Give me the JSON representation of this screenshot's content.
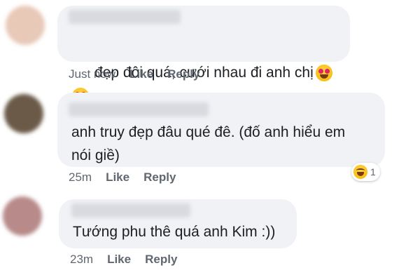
{
  "comments": [
    {
      "text": "đẹp đôi quá, cưới nhau đi anh chị",
      "time": "Just now",
      "like": "Like",
      "reply": "Reply",
      "avatar_color": "#e8c9b8",
      "emoji_icons": [
        "heart-eyes-emoji",
        "heart-eyes-emoji"
      ]
    },
    {
      "text": "anh truy đẹp đâu qué đê. (đố anh hiểu em\nnói giề)",
      "time": "25m",
      "like": "Like",
      "reply": "Reply",
      "avatar_color": "#6b5a48",
      "reaction_icon": "haha-emoji",
      "reaction_count": "1"
    },
    {
      "text": "Tướng phu thê quá anh Kim :))",
      "time": "23m",
      "like": "Like",
      "reply": "Reply",
      "avatar_color": "#b88a8a"
    }
  ]
}
